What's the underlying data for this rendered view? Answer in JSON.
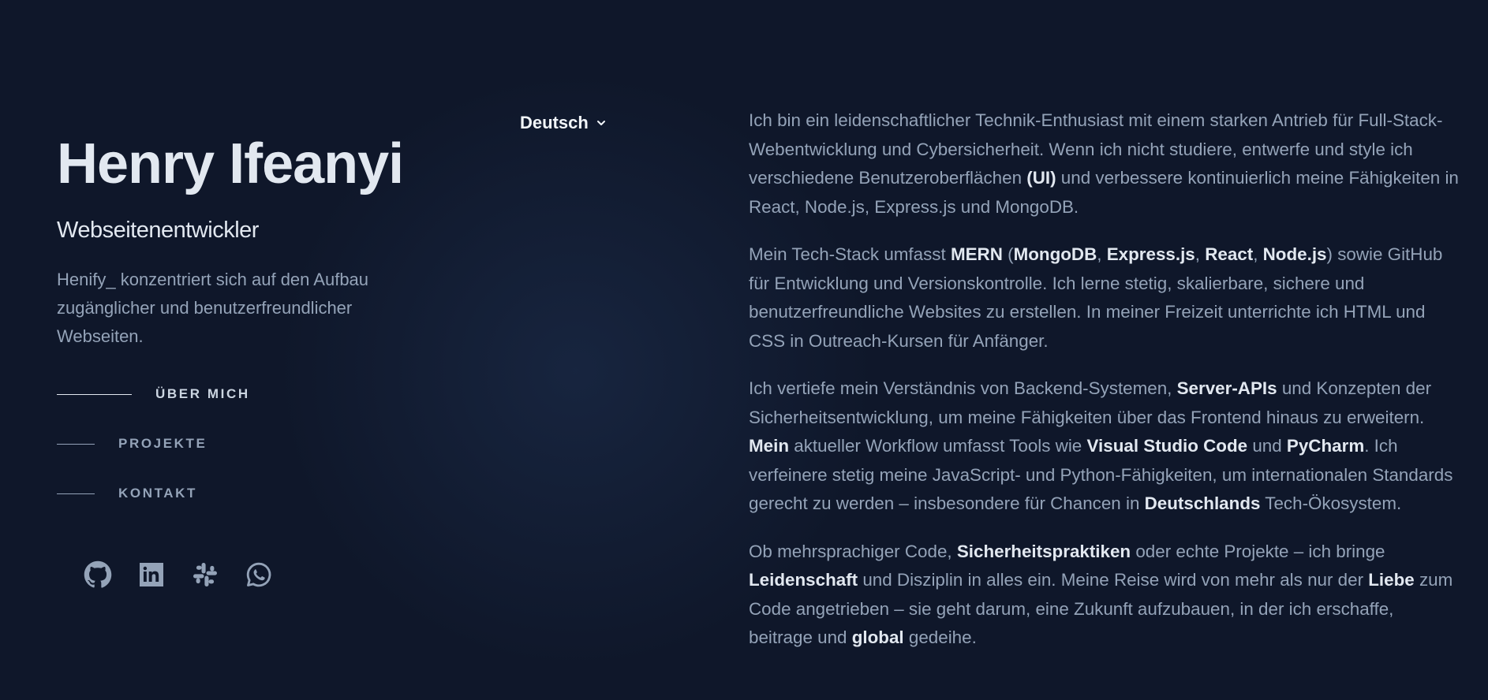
{
  "profile": {
    "name": "Henry Ifeanyi",
    "role": "Webseitenentwickler",
    "tagline": "Henify_ konzentriert sich auf den Aufbau zugänglicher und benutzerfreundlicher Webseiten."
  },
  "nav": {
    "items": [
      {
        "label": "ÜBER MICH",
        "active": true
      },
      {
        "label": "PROJEKTE",
        "active": false
      },
      {
        "label": "KONTAKT",
        "active": false
      }
    ]
  },
  "language": {
    "selected": "Deutsch"
  },
  "socials": [
    {
      "icon": "github-icon"
    },
    {
      "icon": "linkedin-icon"
    },
    {
      "icon": "slack-icon"
    },
    {
      "icon": "whatsapp-icon"
    }
  ],
  "about": {
    "p1": {
      "t1": "Ich bin ein leidenschaftlicher Technik-Enthusiast mit einem starken Antrieb für Full-Stack-Webentwicklung und Cybersicherheit. Wenn ich nicht studiere, entwerfe und style ich verschiedene Benutzeroberflächen ",
      "b1": "(UI)",
      "t2": " und verbessere kontinuierlich meine Fähigkeiten in React, Node.js, Express.js und MongoDB."
    },
    "p2": {
      "t1": "Mein Tech-Stack umfasst ",
      "b1": "MERN",
      "t2": " (",
      "b2": "MongoDB",
      "t3": ", ",
      "b3": "Express.js",
      "t4": ", ",
      "b4": "React",
      "t5": ", ",
      "b5": "Node.js",
      "t6": ") sowie GitHub für Entwicklung und Versionskontrolle. Ich lerne stetig, skalierbare, sichere und benutzerfreundliche Websites zu erstellen. In meiner Freizeit unterrichte ich HTML und CSS in Outreach-Kursen für Anfänger."
    },
    "p3": {
      "t1": "Ich vertiefe mein Verständnis von Backend-Systemen, ",
      "b1": "Server-APIs",
      "t2": " und Konzepten der Sicherheitsentwicklung, um meine Fähigkeiten über das Frontend hinaus zu erweitern. ",
      "b2": "Mein",
      "t3": " aktueller Workflow umfasst Tools wie ",
      "b3": "Visual Studio Code",
      "t4": " und ",
      "b4": "PyCharm",
      "t5": ". Ich verfeinere stetig meine JavaScript- und Python-Fähigkeiten, um internationalen Standards gerecht zu werden – insbesondere für Chancen in ",
      "b5": "Deutschlands",
      "t6": " Tech-Ökosystem."
    },
    "p4": {
      "t1": "Ob mehrsprachiger Code, ",
      "b1": "Sicherheitspraktiken",
      "t2": " oder echte Projekte – ich bringe ",
      "b2": "Leidenschaft",
      "t3": " und Disziplin in alles ein. Meine Reise wird von mehr als nur der ",
      "b3": "Liebe",
      "t4": " zum Code angetrieben – sie geht darum, eine Zukunft aufzubauen, in der ich erschaffe, beitrage und ",
      "b4": "global",
      "t5": " gedeihe."
    }
  },
  "colors": {
    "background": "#0f172a",
    "heading": "#e2e8f0",
    "body_text": "#94a3b8",
    "highlight": "#e2e8f0"
  }
}
